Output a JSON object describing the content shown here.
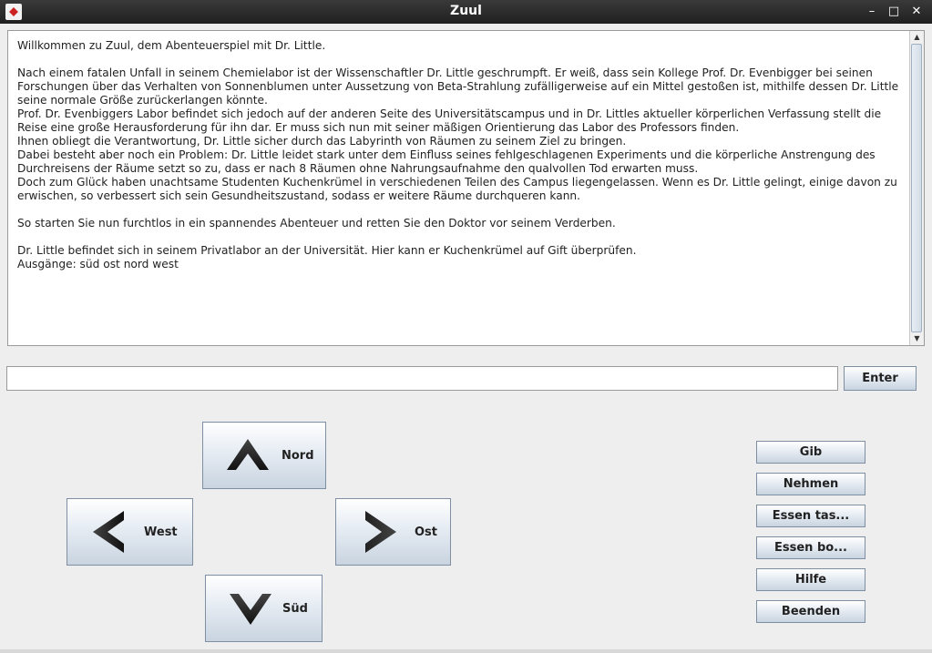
{
  "window": {
    "title": "Zuul",
    "controls": {
      "minimize": "–",
      "maximize": "□",
      "close": "✕"
    }
  },
  "output_text": "Willkommen zu Zuul, dem Abenteuerspiel mit Dr. Little.\n\nNach einem fatalen Unfall in seinem Chemielabor ist der Wissenschaftler Dr. Little geschrumpft. Er weiß, dass sein Kollege Prof. Dr. Evenbigger bei seinen Forschungen über das Verhalten von Sonnenblumen unter Aussetzung von Beta-Strahlung zufälligerweise auf ein Mittel gestoßen ist, mithilfe dessen Dr. Little seine normale Größe zurückerlangen könnte.\nProf. Dr. Evenbiggers Labor befindet sich jedoch auf der anderen Seite des Universitätscampus und in Dr. Littles aktueller körperlichen Verfassung stellt die Reise eine große Herausforderung für ihn dar. Er muss sich nun mit seiner mäßigen Orientierung das Labor des Professors finden.\nIhnen obliegt die Verantwortung, Dr. Little sicher durch das Labyrinth von Räumen zu seinem Ziel zu bringen.\nDabei besteht aber noch ein Problem: Dr. Little leidet stark unter dem Einfluss seines fehlgeschlagenen Experiments und die körperliche Anstrengung des Durchreisens der Räume setzt so zu, dass er nach 8 Räumen ohne Nahrungsaufnahme den qualvollen Tod erwarten muss.\nDoch zum Glück haben unachtsame Studenten Kuchenkrümel in verschiedenen Teilen des Campus liegengelassen. Wenn es Dr. Little gelingt, einige davon zu erwischen, so verbessert sich sein Gesundheitszustand, sodass er weitere Räume durchqueren kann.\n\nSo starten Sie nun furchtlos in ein spannendes Abenteuer und retten Sie den Doktor vor seinem Verderben.\n\nDr. Little befindet sich in seinem Privatlabor an der Universität. Hier kann er Kuchenkrümel auf Gift überprüfen.\nAusgänge: süd ost nord west",
  "input": {
    "value": "",
    "placeholder": ""
  },
  "enter_label": "Enter",
  "nav": {
    "north": "Nord",
    "west": "West",
    "east": "Ost",
    "south": "Süd"
  },
  "actions": [
    "Gib",
    "Nehmen",
    "Essen tas...",
    "Essen bo...",
    "Hilfe",
    "Beenden"
  ],
  "icons": {
    "north": "arrow-up-icon",
    "west": "arrow-left-icon",
    "east": "arrow-right-icon",
    "south": "arrow-down-icon"
  }
}
